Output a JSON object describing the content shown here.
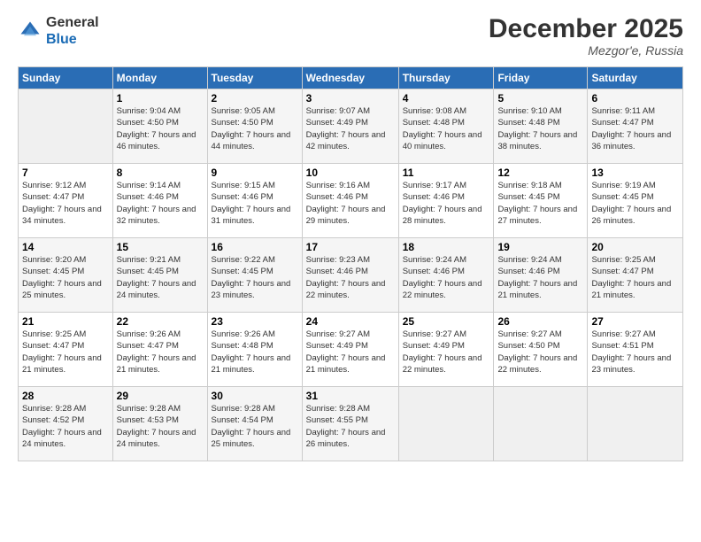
{
  "logo": {
    "general": "General",
    "blue": "Blue"
  },
  "title": "December 2025",
  "location": "Mezgor'e, Russia",
  "days_header": [
    "Sunday",
    "Monday",
    "Tuesday",
    "Wednesday",
    "Thursday",
    "Friday",
    "Saturday"
  ],
  "weeks": [
    [
      {
        "day": "",
        "sunrise": "",
        "sunset": "",
        "daylight": ""
      },
      {
        "day": "1",
        "sunrise": "Sunrise: 9:04 AM",
        "sunset": "Sunset: 4:50 PM",
        "daylight": "Daylight: 7 hours and 46 minutes."
      },
      {
        "day": "2",
        "sunrise": "Sunrise: 9:05 AM",
        "sunset": "Sunset: 4:50 PM",
        "daylight": "Daylight: 7 hours and 44 minutes."
      },
      {
        "day": "3",
        "sunrise": "Sunrise: 9:07 AM",
        "sunset": "Sunset: 4:49 PM",
        "daylight": "Daylight: 7 hours and 42 minutes."
      },
      {
        "day": "4",
        "sunrise": "Sunrise: 9:08 AM",
        "sunset": "Sunset: 4:48 PM",
        "daylight": "Daylight: 7 hours and 40 minutes."
      },
      {
        "day": "5",
        "sunrise": "Sunrise: 9:10 AM",
        "sunset": "Sunset: 4:48 PM",
        "daylight": "Daylight: 7 hours and 38 minutes."
      },
      {
        "day": "6",
        "sunrise": "Sunrise: 9:11 AM",
        "sunset": "Sunset: 4:47 PM",
        "daylight": "Daylight: 7 hours and 36 minutes."
      }
    ],
    [
      {
        "day": "7",
        "sunrise": "Sunrise: 9:12 AM",
        "sunset": "Sunset: 4:47 PM",
        "daylight": "Daylight: 7 hours and 34 minutes."
      },
      {
        "day": "8",
        "sunrise": "Sunrise: 9:14 AM",
        "sunset": "Sunset: 4:46 PM",
        "daylight": "Daylight: 7 hours and 32 minutes."
      },
      {
        "day": "9",
        "sunrise": "Sunrise: 9:15 AM",
        "sunset": "Sunset: 4:46 PM",
        "daylight": "Daylight: 7 hours and 31 minutes."
      },
      {
        "day": "10",
        "sunrise": "Sunrise: 9:16 AM",
        "sunset": "Sunset: 4:46 PM",
        "daylight": "Daylight: 7 hours and 29 minutes."
      },
      {
        "day": "11",
        "sunrise": "Sunrise: 9:17 AM",
        "sunset": "Sunset: 4:46 PM",
        "daylight": "Daylight: 7 hours and 28 minutes."
      },
      {
        "day": "12",
        "sunrise": "Sunrise: 9:18 AM",
        "sunset": "Sunset: 4:45 PM",
        "daylight": "Daylight: 7 hours and 27 minutes."
      },
      {
        "day": "13",
        "sunrise": "Sunrise: 9:19 AM",
        "sunset": "Sunset: 4:45 PM",
        "daylight": "Daylight: 7 hours and 26 minutes."
      }
    ],
    [
      {
        "day": "14",
        "sunrise": "Sunrise: 9:20 AM",
        "sunset": "Sunset: 4:45 PM",
        "daylight": "Daylight: 7 hours and 25 minutes."
      },
      {
        "day": "15",
        "sunrise": "Sunrise: 9:21 AM",
        "sunset": "Sunset: 4:45 PM",
        "daylight": "Daylight: 7 hours and 24 minutes."
      },
      {
        "day": "16",
        "sunrise": "Sunrise: 9:22 AM",
        "sunset": "Sunset: 4:45 PM",
        "daylight": "Daylight: 7 hours and 23 minutes."
      },
      {
        "day": "17",
        "sunrise": "Sunrise: 9:23 AM",
        "sunset": "Sunset: 4:46 PM",
        "daylight": "Daylight: 7 hours and 22 minutes."
      },
      {
        "day": "18",
        "sunrise": "Sunrise: 9:24 AM",
        "sunset": "Sunset: 4:46 PM",
        "daylight": "Daylight: 7 hours and 22 minutes."
      },
      {
        "day": "19",
        "sunrise": "Sunrise: 9:24 AM",
        "sunset": "Sunset: 4:46 PM",
        "daylight": "Daylight: 7 hours and 21 minutes."
      },
      {
        "day": "20",
        "sunrise": "Sunrise: 9:25 AM",
        "sunset": "Sunset: 4:47 PM",
        "daylight": "Daylight: 7 hours and 21 minutes."
      }
    ],
    [
      {
        "day": "21",
        "sunrise": "Sunrise: 9:25 AM",
        "sunset": "Sunset: 4:47 PM",
        "daylight": "Daylight: 7 hours and 21 minutes."
      },
      {
        "day": "22",
        "sunrise": "Sunrise: 9:26 AM",
        "sunset": "Sunset: 4:47 PM",
        "daylight": "Daylight: 7 hours and 21 minutes."
      },
      {
        "day": "23",
        "sunrise": "Sunrise: 9:26 AM",
        "sunset": "Sunset: 4:48 PM",
        "daylight": "Daylight: 7 hours and 21 minutes."
      },
      {
        "day": "24",
        "sunrise": "Sunrise: 9:27 AM",
        "sunset": "Sunset: 4:49 PM",
        "daylight": "Daylight: 7 hours and 21 minutes."
      },
      {
        "day": "25",
        "sunrise": "Sunrise: 9:27 AM",
        "sunset": "Sunset: 4:49 PM",
        "daylight": "Daylight: 7 hours and 22 minutes."
      },
      {
        "day": "26",
        "sunrise": "Sunrise: 9:27 AM",
        "sunset": "Sunset: 4:50 PM",
        "daylight": "Daylight: 7 hours and 22 minutes."
      },
      {
        "day": "27",
        "sunrise": "Sunrise: 9:27 AM",
        "sunset": "Sunset: 4:51 PM",
        "daylight": "Daylight: 7 hours and 23 minutes."
      }
    ],
    [
      {
        "day": "28",
        "sunrise": "Sunrise: 9:28 AM",
        "sunset": "Sunset: 4:52 PM",
        "daylight": "Daylight: 7 hours and 24 minutes."
      },
      {
        "day": "29",
        "sunrise": "Sunrise: 9:28 AM",
        "sunset": "Sunset: 4:53 PM",
        "daylight": "Daylight: 7 hours and 24 minutes."
      },
      {
        "day": "30",
        "sunrise": "Sunrise: 9:28 AM",
        "sunset": "Sunset: 4:54 PM",
        "daylight": "Daylight: 7 hours and 25 minutes."
      },
      {
        "day": "31",
        "sunrise": "Sunrise: 9:28 AM",
        "sunset": "Sunset: 4:55 PM",
        "daylight": "Daylight: 7 hours and 26 minutes."
      },
      {
        "day": "",
        "sunrise": "",
        "sunset": "",
        "daylight": ""
      },
      {
        "day": "",
        "sunrise": "",
        "sunset": "",
        "daylight": ""
      },
      {
        "day": "",
        "sunrise": "",
        "sunset": "",
        "daylight": ""
      }
    ]
  ]
}
